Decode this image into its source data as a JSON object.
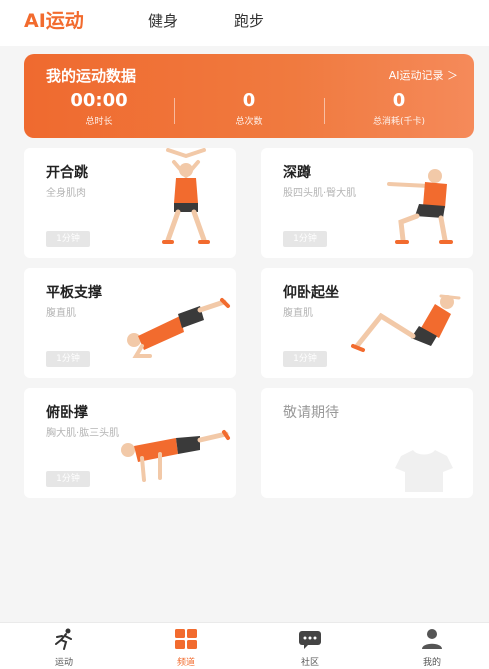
{
  "header": {
    "tabs": [
      {
        "label": "AI运动",
        "active": true
      },
      {
        "label": "健身",
        "active": false
      },
      {
        "label": "跑步",
        "active": false
      }
    ]
  },
  "stats": {
    "title": "我的运动数据",
    "link": "AI运动记录 ＞",
    "items": [
      {
        "value": "00:00",
        "label": "总时长"
      },
      {
        "value": "0",
        "label": "总次数"
      },
      {
        "value": "0",
        "label": "总消耗(千卡)"
      }
    ]
  },
  "exercises": [
    {
      "name": "开合跳",
      "muscle": "全身肌肉",
      "duration": "1分钟",
      "figure": "jumping-jack-figure"
    },
    {
      "name": "深蹲",
      "muscle": "股四头肌·臀大肌",
      "duration": "1分钟",
      "figure": "squat-figure"
    },
    {
      "name": "平板支撑",
      "muscle": "腹直肌",
      "duration": "1分钟",
      "figure": "plank-figure"
    },
    {
      "name": "仰卧起坐",
      "muscle": "腹直肌",
      "duration": "1分钟",
      "figure": "situp-figure"
    },
    {
      "name": "俯卧撑",
      "muscle": "胸大肌·肱三头肌",
      "duration": "1分钟",
      "figure": "pushup-figure"
    }
  ],
  "placeholder": {
    "label": "敬请期待",
    "icon": "shirt-icon"
  },
  "bottom_nav": [
    {
      "label": "运动",
      "icon": "runner-icon",
      "active": false
    },
    {
      "label": "频道",
      "icon": "grid-icon",
      "active": true
    },
    {
      "label": "社区",
      "icon": "chat-icon",
      "active": false
    },
    {
      "label": "我的",
      "icon": "person-icon",
      "active": false
    }
  ],
  "colors": {
    "accent": "#f26b2e",
    "figure_shirt": "#f26b2e",
    "figure_shorts": "#3a3a3a",
    "skin": "#f2c9a8"
  }
}
